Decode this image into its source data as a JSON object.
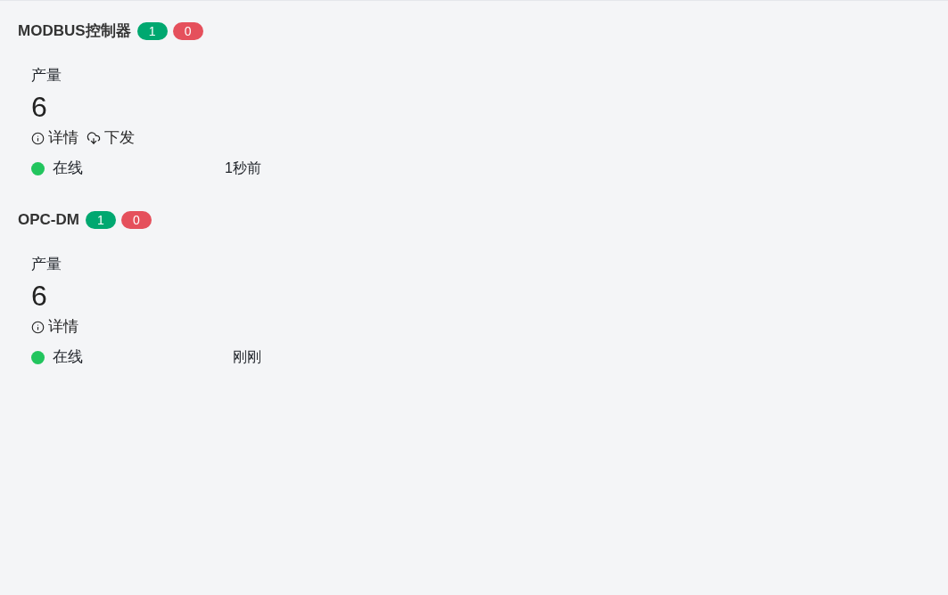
{
  "groups": [
    {
      "name": "MODBUS控制器",
      "badges": [
        {
          "text": "1",
          "color": "#00a870"
        },
        {
          "text": "0",
          "color": "#e5505c"
        }
      ],
      "card": {
        "label": "产量",
        "value": "6",
        "actions": [
          {
            "kind": "detail",
            "label": "详情"
          },
          {
            "kind": "download",
            "label": "下发"
          }
        ],
        "status": {
          "text": "在线",
          "color": "#22c55e"
        },
        "time": "1秒前"
      }
    },
    {
      "name": "OPC-DM",
      "badges": [
        {
          "text": "1",
          "color": "#00a870"
        },
        {
          "text": "0",
          "color": "#e5505c"
        }
      ],
      "card": {
        "label": "产量",
        "value": "6",
        "actions": [
          {
            "kind": "detail",
            "label": "详情"
          }
        ],
        "status": {
          "text": "在线",
          "color": "#22c55e"
        },
        "time": "刚刚"
      }
    }
  ]
}
